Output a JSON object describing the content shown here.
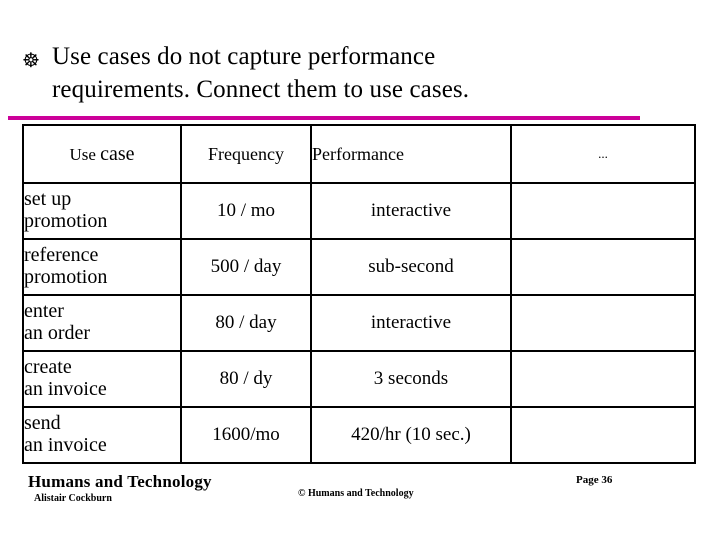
{
  "slide": {
    "bullet_glyph": "☸",
    "heading_line1": "Use cases do not capture performance",
    "heading_line2": "requirements.  Connect them to use cases.",
    "rule_color": "#cc0099"
  },
  "table": {
    "headers": {
      "use_case_prefix": "Use ",
      "use_case_suffix": "case",
      "frequency": "Frequency",
      "performance": "Performance",
      "more": "..."
    },
    "rows": [
      {
        "use_case_line1": "set up",
        "use_case_line2": "promotion",
        "frequency": "10 / mo",
        "performance": "interactive",
        "extra": ""
      },
      {
        "use_case_line1": "reference",
        "use_case_line2": "promotion",
        "frequency": "500 / day",
        "performance": "sub-second",
        "extra": ""
      },
      {
        "use_case_line1": "enter",
        "use_case_line2": "an order",
        "frequency": "80 / day",
        "performance": "interactive",
        "extra": ""
      },
      {
        "use_case_line1": "create",
        "use_case_line2": "an invoice",
        "frequency": "80 / dy",
        "performance": "3 seconds",
        "extra": ""
      },
      {
        "use_case_line1": "send",
        "use_case_line2": "an invoice",
        "frequency": "1600/mo",
        "performance": "420/hr (10 sec.)",
        "extra": ""
      }
    ]
  },
  "footer": {
    "organization": "Humans and Technology",
    "author": "Alistair Cockburn",
    "copyright": "© Humans and Technology",
    "page": "Page 36"
  }
}
